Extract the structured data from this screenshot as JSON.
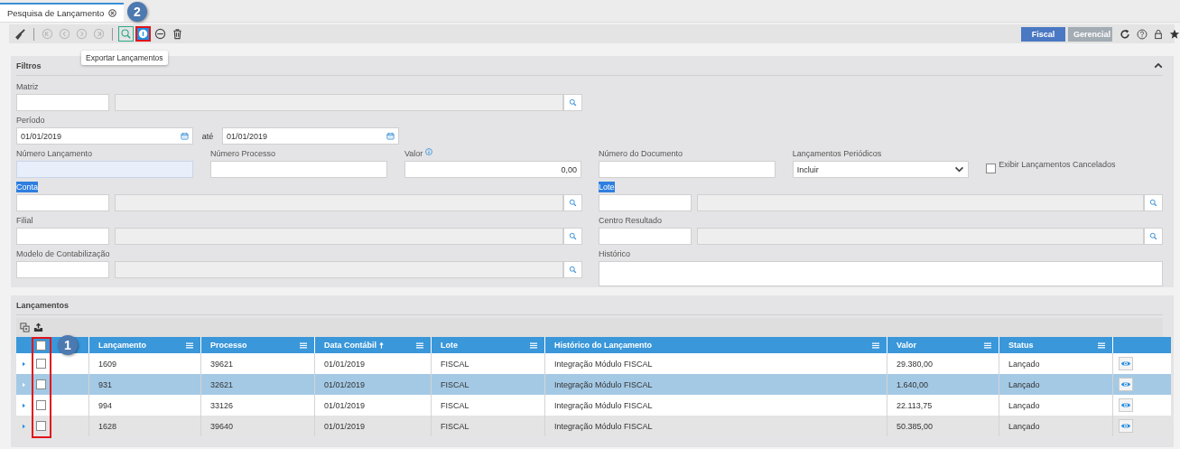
{
  "tab": {
    "label": "Pesquisa de Lançamento",
    "selected": true
  },
  "callouts": {
    "toolbar": "2",
    "table": "1"
  },
  "toolbar": {
    "groups": [
      [
        {
          "kind": "brush",
          "disabled": false,
          "focused": false,
          "annotated": false
        }
      ],
      [
        {
          "kind": "first",
          "disabled": true,
          "focused": false,
          "annotated": false
        },
        {
          "kind": "prev",
          "disabled": true,
          "focused": false,
          "annotated": false
        },
        {
          "kind": "next",
          "disabled": true,
          "focused": false,
          "annotated": false
        },
        {
          "kind": "last",
          "disabled": true,
          "focused": false,
          "annotated": false
        }
      ],
      [
        {
          "kind": "search",
          "disabled": false,
          "focused": true,
          "annotated": false
        },
        {
          "kind": "export",
          "disabled": false,
          "focused": false,
          "annotated": true
        },
        {
          "kind": "remove",
          "disabled": false,
          "focused": false,
          "annotated": false
        },
        {
          "kind": "delete",
          "disabled": false,
          "focused": false,
          "annotated": false
        }
      ]
    ],
    "tooltip": "Exportar Lançamentos",
    "views": [
      {
        "label": "Fiscal",
        "selected": true
      },
      {
        "label": "Gerencial",
        "selected": false
      }
    ]
  },
  "filters": {
    "title": "Filtros",
    "expanded": true,
    "matriz": {
      "label": "Matriz"
    },
    "periodo": {
      "label": "Período",
      "from": "01/01/2019",
      "separator": "até",
      "to": "01/01/2019"
    },
    "numero_lancamento": {
      "label": "Número Lançamento",
      "focused": true
    },
    "numero_processo": {
      "label": "Número Processo"
    },
    "valor": {
      "label": "Valor",
      "value": "0,00"
    },
    "numero_documento": {
      "label": "Número do Documento"
    },
    "lancamentos_periodicos": {
      "label": "Lançamentos Periódicos",
      "value": "Incluir"
    },
    "exibir_cancelados": {
      "label": "Exibir Lançamentos Cancelados",
      "checked": false
    },
    "conta": {
      "label": "Conta",
      "highlighted": true
    },
    "lote": {
      "label": "Lote",
      "highlighted": true
    },
    "filial": {
      "label": "Filial",
      "highlighted": false
    },
    "centro_resultado": {
      "label": "Centro Resultado",
      "highlighted": false
    },
    "modelo": {
      "label": "Modelo de Contabilização",
      "highlighted": false
    },
    "historico": {
      "label": "Histórico"
    }
  },
  "lancamentos": {
    "title": "Lançamentos",
    "all_checked": false,
    "checkbox_annotated": true,
    "columns": [
      {
        "label": "Lançamento",
        "sorted": false
      },
      {
        "label": "Processo",
        "sorted": false
      },
      {
        "label": "Data Contábil",
        "sorted": true
      },
      {
        "label": "Lote",
        "sorted": false
      },
      {
        "label": "Histórico do Lançamento",
        "sorted": false
      },
      {
        "label": "Valor",
        "sorted": false
      },
      {
        "label": "Status",
        "sorted": false
      }
    ],
    "rows": [
      {
        "selected": false,
        "hovered": false,
        "checked": false,
        "cells": [
          "1609",
          "39621",
          "01/01/2019",
          "FISCAL",
          "Integração Módulo FISCAL",
          "29.380,00",
          "Lançado"
        ]
      },
      {
        "selected": true,
        "hovered": false,
        "checked": false,
        "cells": [
          "931",
          "32621",
          "01/01/2019",
          "FISCAL",
          "Integração Módulo FISCAL",
          "1.640,00",
          "Lançado"
        ]
      },
      {
        "selected": false,
        "hovered": false,
        "checked": false,
        "cells": [
          "994",
          "33126",
          "01/01/2019",
          "FISCAL",
          "Integração Módulo FISCAL",
          "22.113,75",
          "Lançado"
        ]
      },
      {
        "selected": false,
        "hovered": true,
        "checked": false,
        "cells": [
          "1628",
          "39640",
          "01/01/2019",
          "FISCAL",
          "Integração Módulo FISCAL",
          "50.385,00",
          "Lançado"
        ]
      }
    ]
  }
}
